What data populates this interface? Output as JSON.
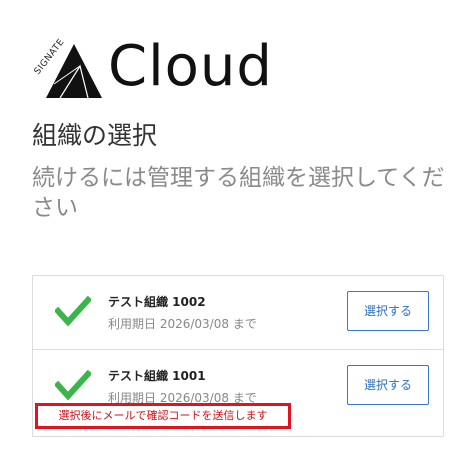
{
  "logo": {
    "brand": "SIGNATE",
    "product": "Cloud",
    "icon": "signate-triangle-logo"
  },
  "page_title": "組織の選択",
  "subtitle": "続けるには管理する組織を選択してください",
  "colors": {
    "check": "#3bb54a",
    "accent": "#2f6fc0",
    "notice": "#e0141e"
  },
  "organizations": [
    {
      "name": "テスト組織 1002",
      "expires": "利用期日 2026/03/08 まで",
      "select_label": "選択する",
      "icon": "check-icon"
    },
    {
      "name": "テスト組織 1001",
      "expires": "利用期日 2026/03/08 まで",
      "select_label": "選択する",
      "icon": "check-icon"
    }
  ],
  "notice": "選択後にメールで確認コードを送信します"
}
